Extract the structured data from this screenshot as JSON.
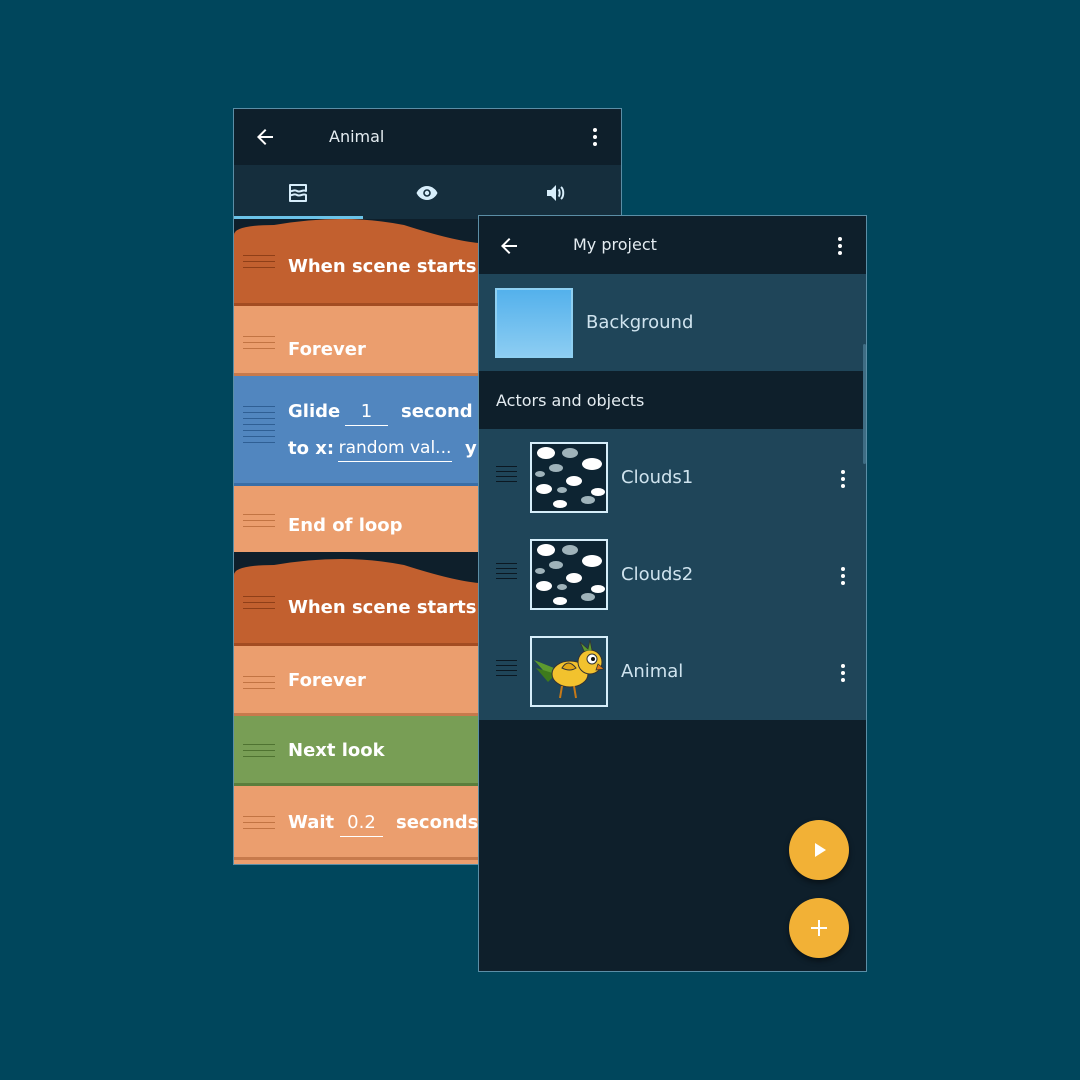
{
  "scripts_screen": {
    "title": "Animal",
    "tabs": [
      {
        "icon": "scripts-icon",
        "active": true
      },
      {
        "icon": "eye-icon",
        "active": false
      },
      {
        "icon": "sound-icon",
        "active": false
      }
    ],
    "bricks": [
      {
        "label": "When scene starts",
        "kind": "event"
      },
      {
        "label": "Forever",
        "kind": "control"
      },
      {
        "line1": "Glide",
        "duration": "1",
        "unit": "second",
        "line2_prefix": "to x:",
        "x_value": "random val...",
        "y_prefix": "y:",
        "kind": "motion"
      },
      {
        "label": "End of loop",
        "kind": "control"
      },
      {
        "label": "When scene starts",
        "kind": "event"
      },
      {
        "label": "Forever",
        "kind": "control"
      },
      {
        "label": "Next look",
        "kind": "looks"
      },
      {
        "prefix": "Wait",
        "value": "0.2",
        "suffix": "seconds",
        "kind": "control"
      }
    ],
    "colors": {
      "event": "#c2602f",
      "control": "#eb9e6e",
      "motion": "#5186bf",
      "looks": "#789e55"
    }
  },
  "project_screen": {
    "title": "My project",
    "background": {
      "name": "Background",
      "color": "#5db6ea"
    },
    "section_header": "Actors and objects",
    "objects": [
      {
        "name": "Clouds1",
        "thumbnail": "clouds"
      },
      {
        "name": "Clouds2",
        "thumbnail": "clouds"
      },
      {
        "name": "Animal",
        "thumbnail": "bird"
      }
    ],
    "fabs": [
      {
        "icon": "play-icon"
      },
      {
        "icon": "plus-icon"
      }
    ],
    "accent": "#f2b136"
  }
}
